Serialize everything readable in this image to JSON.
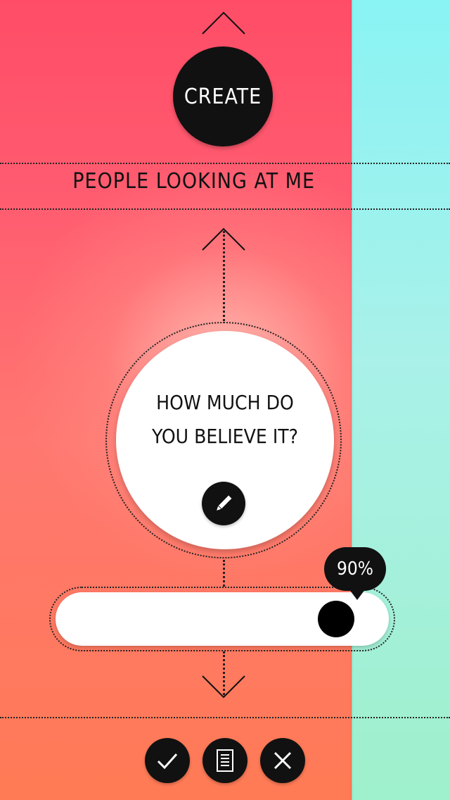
{
  "header": {
    "create_label": "Create"
  },
  "section": {
    "title": "People looking at me"
  },
  "question": {
    "line1": "How much do",
    "line2": "you believe it?"
  },
  "belief_slider": {
    "value_label": "90%",
    "value": 0.9
  },
  "icons": {
    "up_top": "chevron-up-icon",
    "up_mid": "chevron-up-icon",
    "down": "chevron-down-icon",
    "edit": "pencil-icon",
    "confirm": "check-icon",
    "notes": "document-icon",
    "close": "close-icon"
  },
  "colors": {
    "left_panel_top": "#ff4d67",
    "left_panel_bottom": "#ff7b55",
    "right_panel_top": "#8af3f4",
    "right_panel_bottom": "#9ff0cc",
    "ink": "#111111"
  }
}
